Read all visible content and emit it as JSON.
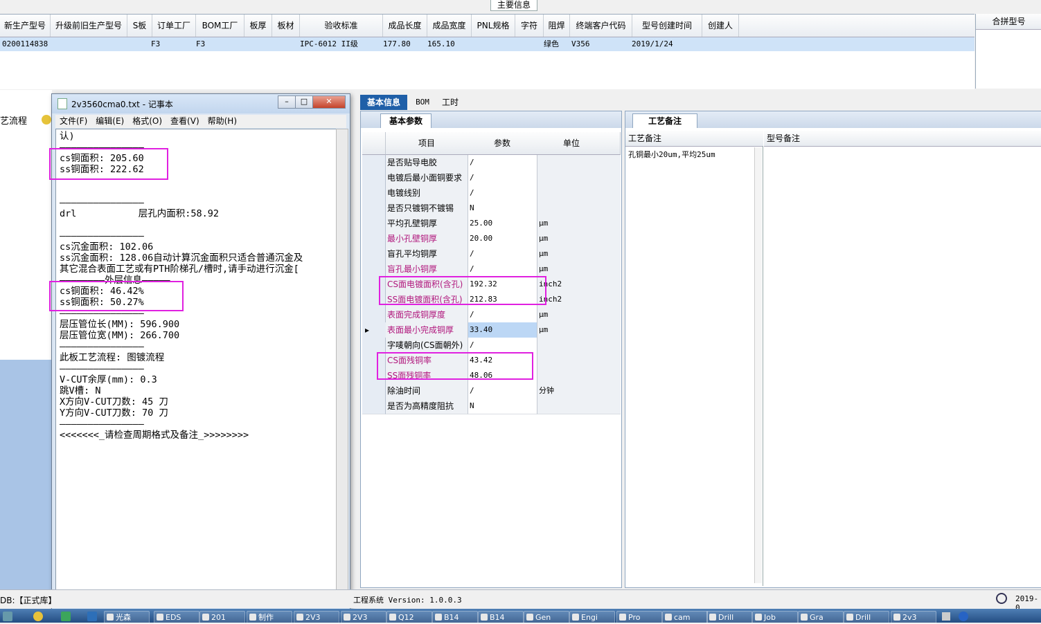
{
  "header": {
    "main_tab": "主要信息",
    "columns": [
      "新生产型号",
      "升级前旧生产型号",
      "S板",
      "订单工厂",
      "BOM工厂",
      "板厚",
      "板材",
      "验收标准",
      "成品长度",
      "成品宽度",
      "PNL规格",
      "字符",
      "阻焊",
      "终端客户代码",
      "型号创建时间",
      "创建人"
    ],
    "row": [
      "0200114838",
      "",
      "F3",
      "F3",
      "",
      "",
      "",
      "IPC-6012 II级",
      "177.80",
      "165.10",
      "",
      "",
      "绿色",
      "V356",
      "2019/1/24",
      ""
    ],
    "merge_label": "合拼型号"
  },
  "left_pane": {
    "label": "艺流程"
  },
  "notepad": {
    "title": "2v3560cma0.txt - 记事本",
    "menu": [
      "文件(F)",
      "编辑(E)",
      "格式(O)",
      "查看(V)",
      "帮助(H)"
    ],
    "lines": [
      "认)",
      "———————————————",
      "cs铜面积: 205.60",
      "ss铜面积: 222.62",
      "",
      "",
      "———————————————",
      "drl           层孔内面积:58.92",
      "",
      "———————————————",
      "cs沉金面积: 102.06",
      "ss沉金面积: 128.06自动计算沉金面积只适合普通沉金及",
      "其它混合表面工艺或有PTH阶梯孔/槽时,请手动进行沉金[",
      "————————外层信息—————",
      "cs铜面积: 46.42%",
      "ss铜面积: 50.27%",
      "———————————————",
      "层压管位长(MM): 596.900",
      "层压管位宽(MM): 266.700",
      "———————————————",
      "此板工艺流程: 图镀流程",
      "———————————————",
      "V-CUT余厚(mm): 0.3",
      "跳V槽: N",
      "X方向V-CUT刀数: 45 刀",
      "Y方向V-CUT刀数: 70 刀",
      "———————————————",
      "<<<<<<<_请检查周期格式及备注_>>>>>>>>"
    ]
  },
  "right_tabs": [
    "基本信息",
    "BOM",
    "工时"
  ],
  "params": {
    "sub_tab": "基本参数",
    "headers": [
      "项目",
      "参数",
      "单位"
    ],
    "rows": [
      {
        "item": "是否贴导电胶",
        "value": "/",
        "unit": "",
        "red": false
      },
      {
        "item": "电镀后最小面铜要求",
        "value": "/",
        "unit": "",
        "red": false
      },
      {
        "item": "电镀线别",
        "value": "/",
        "unit": "",
        "red": false
      },
      {
        "item": "是否只镀铜不镀锡",
        "value": "N",
        "unit": "",
        "red": false
      },
      {
        "item": "平均孔壁铜厚",
        "value": "25.00",
        "unit": "μm",
        "red": false
      },
      {
        "item": "最小孔壁铜厚",
        "value": "20.00",
        "unit": "μm",
        "red": true
      },
      {
        "item": "盲孔平均铜厚",
        "value": "/",
        "unit": "μm",
        "red": false
      },
      {
        "item": "盲孔最小铜厚",
        "value": "/",
        "unit": "μm",
        "red": true
      },
      {
        "item": "CS面电镀面积(含孔)",
        "value": "192.32",
        "unit": "inch2",
        "red": true
      },
      {
        "item": "SS面电镀面积(含孔)",
        "value": "212.83",
        "unit": "inch2",
        "red": true
      },
      {
        "item": "表面完成铜厚度",
        "value": "/",
        "unit": "μm",
        "red": true
      },
      {
        "item": "表面最小完成铜厚",
        "value": "33.40",
        "unit": "μm",
        "red": true
      },
      {
        "item": "字唛朝向(CS面朝外)",
        "value": "/",
        "unit": "",
        "red": false
      },
      {
        "item": "CS面残铜率",
        "value": "43.42",
        "unit": "",
        "red": true
      },
      {
        "item": "SS面残铜率",
        "value": "48.06",
        "unit": "",
        "red": true
      },
      {
        "item": "除油时间",
        "value": "/",
        "unit": "分钟",
        "red": false
      },
      {
        "item": "是否为高精度阻抗",
        "value": "N",
        "unit": "",
        "red": false
      }
    ]
  },
  "remarks": {
    "sub_tab": "工艺备注",
    "col1": "工艺备注",
    "col2": "型号备注",
    "text": "孔铜最小20um,平均25um"
  },
  "status": {
    "left": "DB:【正式库】",
    "mid": "工程系统 Version: 1.0.0.3",
    "right": "2019-0"
  },
  "taskbar": [
    "光森",
    "EDS",
    "201",
    "制作",
    "2V3",
    "2V3",
    "Q12",
    "B14",
    "B14",
    "Gen",
    "Engi",
    "Pro",
    "cam",
    "Drill",
    "Job",
    "Gra",
    "Drill",
    "2v3"
  ]
}
